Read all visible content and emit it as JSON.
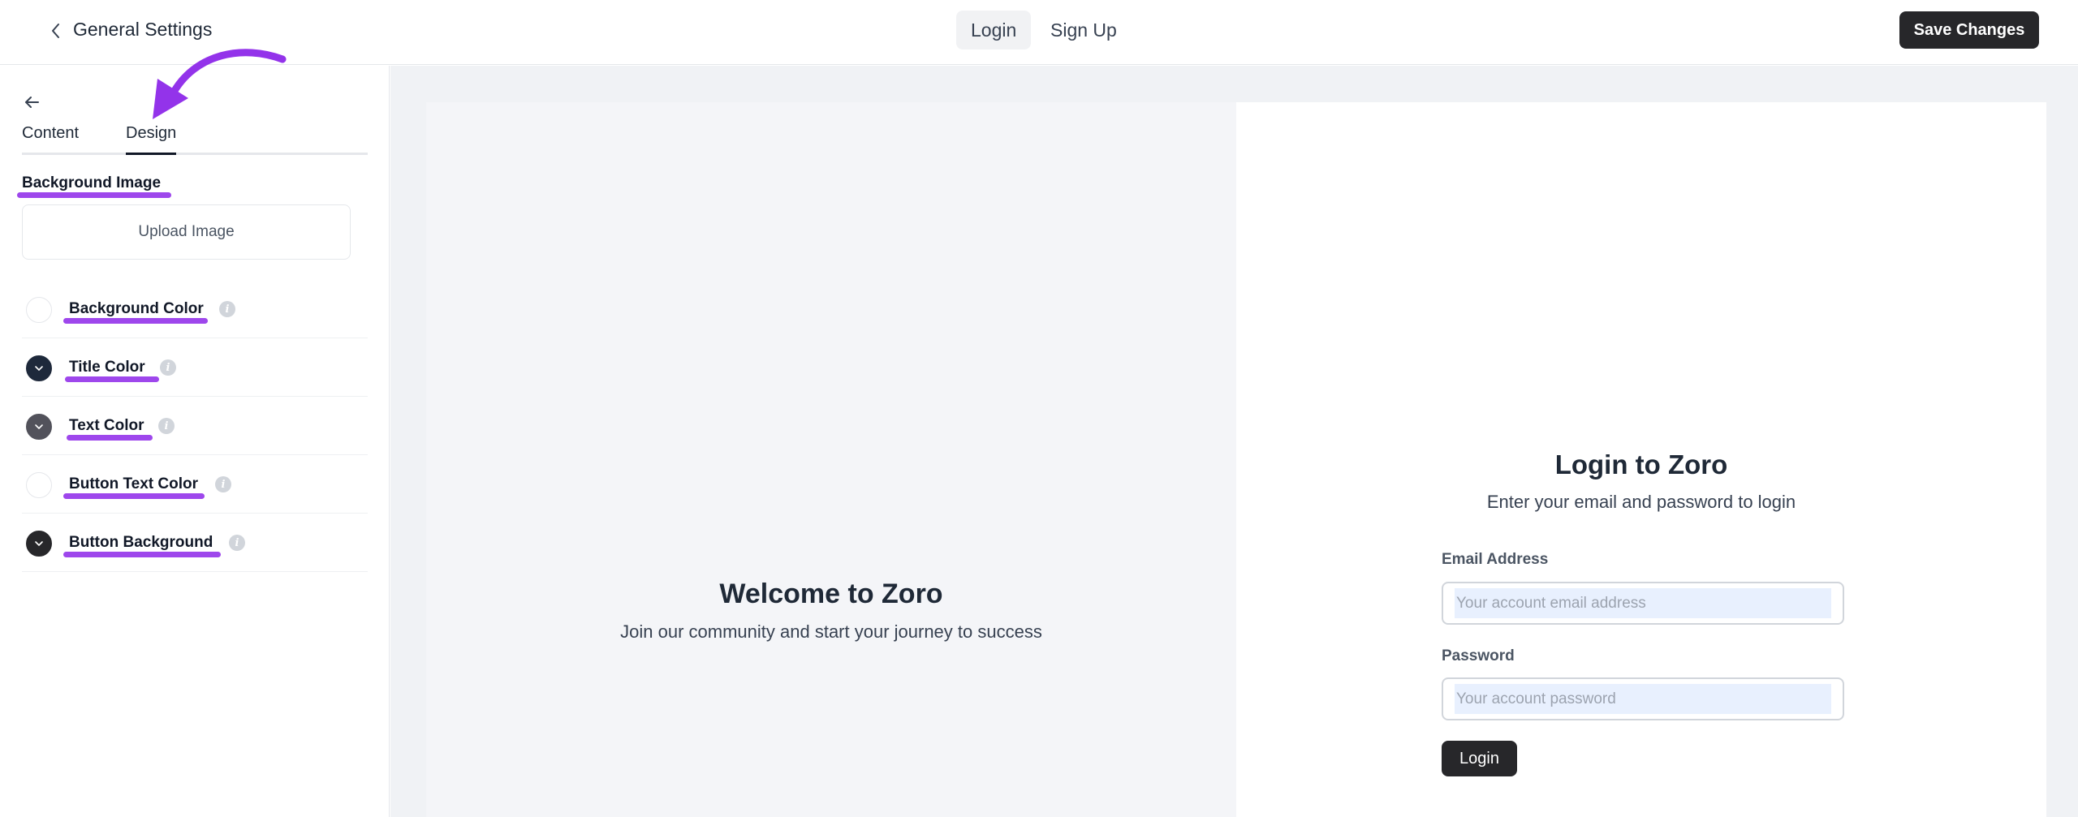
{
  "header": {
    "title": "General Settings",
    "tabs": [
      {
        "label": "Login",
        "active": true
      },
      {
        "label": "Sign Up",
        "active": false
      }
    ],
    "save_label": "Save Changes"
  },
  "sidebar": {
    "tabs": [
      {
        "label": "Content",
        "active": false
      },
      {
        "label": "Design",
        "active": true
      }
    ],
    "background_image_label": "Background Image",
    "upload_label": "Upload Image",
    "colors": [
      {
        "label": "Background Color",
        "swatch": "#ffffff"
      },
      {
        "label": "Title Color",
        "swatch": "#1e293b"
      },
      {
        "label": "Text Color",
        "swatch": "#52525b"
      },
      {
        "label": "Button Text Color",
        "swatch": "#ffffff"
      },
      {
        "label": "Button Background",
        "swatch": "#27272a"
      }
    ],
    "info_glyph": "i"
  },
  "preview": {
    "welcome_title": "Welcome to Zoro",
    "welcome_subtitle": "Join our community and start your journey to success",
    "login_title": "Login to Zoro",
    "login_subtitle": "Enter your email and password to login",
    "email_label": "Email Address",
    "email_placeholder": "Your account email address",
    "password_label": "Password",
    "password_placeholder": "Your account password",
    "login_button": "Login"
  },
  "colors": {
    "annotation": "#9333ea",
    "primary_button": "#27272a"
  }
}
